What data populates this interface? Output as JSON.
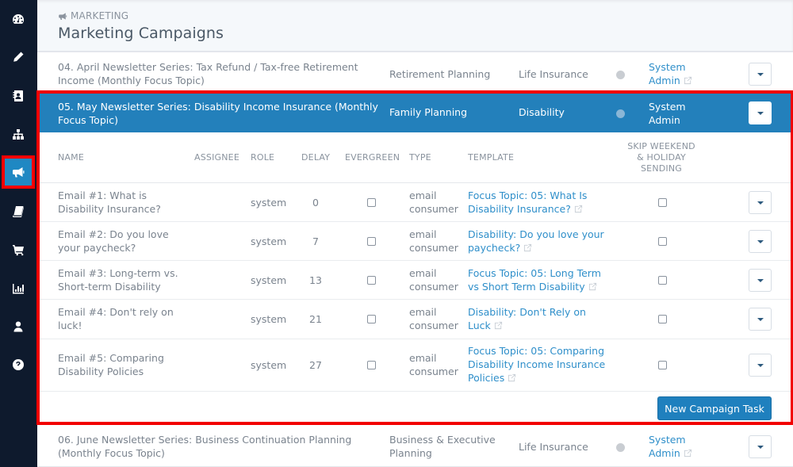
{
  "sidebar": {
    "items": [
      {
        "icon": "dashboard-icon",
        "active": false
      },
      {
        "icon": "pencil-icon",
        "active": false
      },
      {
        "icon": "contacts-icon",
        "active": false
      },
      {
        "icon": "hierarchy-icon",
        "active": false
      },
      {
        "icon": "megaphone-icon",
        "active": true
      },
      {
        "icon": "book-icon",
        "active": false
      },
      {
        "icon": "cart-icon",
        "active": false
      },
      {
        "icon": "bar-chart-icon",
        "active": false
      },
      {
        "icon": "user-icon",
        "active": false
      },
      {
        "icon": "help-icon",
        "active": false
      }
    ]
  },
  "header": {
    "breadcrumb": "MARKETING",
    "title": "Marketing Campaigns"
  },
  "campaigns": [
    {
      "name": "04. April Newsletter Series: Tax Refund / Tax-free Retirement Income (Monthly Focus Topic)",
      "category": "Retirement Planning",
      "product": "Life Insurance",
      "owner": "System Admin"
    },
    {
      "name": "05. May Newsletter Series: Disability Income Insurance (Monthly Focus Topic)",
      "category": "Family Planning",
      "product": "Disability",
      "owner": "System Admin",
      "expanded": true
    },
    {
      "name": "06. June Newsletter Series: Business Continuation Planning (Monthly Focus Topic)",
      "category": "Business & Executive Planning",
      "product": "Life Insurance",
      "owner": "System Admin"
    }
  ],
  "tasks_table": {
    "columns": {
      "name": "NAME",
      "assignee": "ASSIGNEE",
      "role": "ROLE",
      "delay": "DELAY",
      "evergreen": "EVERGREEN",
      "type": "TYPE",
      "template": "TEMPLATE",
      "skip": "SKIP WEEKEND & HOLIDAY SENDING"
    },
    "rows": [
      {
        "name": "Email #1: What is Disability Insurance?",
        "assignee": "",
        "role": "system",
        "delay": "0",
        "evergreen": false,
        "type": "email consumer",
        "template": "Focus Topic: 05: What Is Disability Insurance?",
        "skip": false
      },
      {
        "name": "Email #2: Do you love your paycheck?",
        "assignee": "",
        "role": "system",
        "delay": "7",
        "evergreen": false,
        "type": "email consumer",
        "template": "Disability: Do you love your paycheck?",
        "skip": false
      },
      {
        "name": "Email #3: Long-term vs. Short-term Disability",
        "assignee": "",
        "role": "system",
        "delay": "13",
        "evergreen": false,
        "type": "email consumer",
        "template": "Focus Topic: 05: Long Term vs Short Term Disability",
        "skip": false
      },
      {
        "name": "Email #4: Don't rely on luck!",
        "assignee": "",
        "role": "system",
        "delay": "21",
        "evergreen": false,
        "type": "email consumer",
        "template": "Disability: Don't Rely on Luck",
        "skip": false
      },
      {
        "name": "Email #5: Comparing Disability Policies",
        "assignee": "",
        "role": "system",
        "delay": "27",
        "evergreen": false,
        "type": "email consumer",
        "template": "Focus Topic: 05: Comparing Disability Income Insurance Policies",
        "skip": false
      }
    ],
    "new_task_label": "New Campaign Task"
  },
  "colors": {
    "sidebar_bg": "#0e1a2d",
    "accent": "#2380bb",
    "link": "#2f8fca",
    "highlight_outline": "#f20000"
  }
}
